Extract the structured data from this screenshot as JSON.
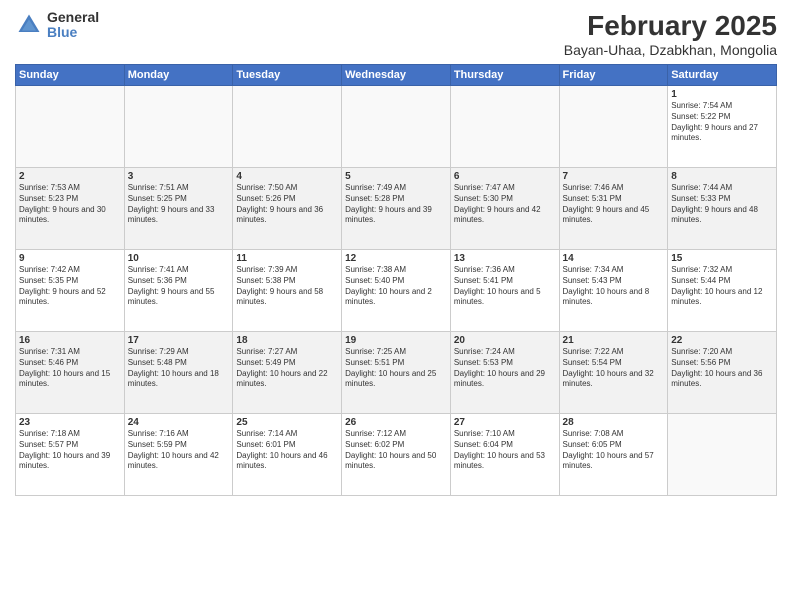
{
  "logo": {
    "general": "General",
    "blue": "Blue"
  },
  "header": {
    "title": "February 2025",
    "subtitle": "Bayan-Uhaa, Dzabkhan, Mongolia"
  },
  "calendar": {
    "headers": [
      "Sunday",
      "Monday",
      "Tuesday",
      "Wednesday",
      "Thursday",
      "Friday",
      "Saturday"
    ],
    "rows": [
      [
        {
          "day": "",
          "info": ""
        },
        {
          "day": "",
          "info": ""
        },
        {
          "day": "",
          "info": ""
        },
        {
          "day": "",
          "info": ""
        },
        {
          "day": "",
          "info": ""
        },
        {
          "day": "",
          "info": ""
        },
        {
          "day": "1",
          "info": "Sunrise: 7:54 AM\nSunset: 5:22 PM\nDaylight: 9 hours and 27 minutes."
        }
      ],
      [
        {
          "day": "2",
          "info": "Sunrise: 7:53 AM\nSunset: 5:23 PM\nDaylight: 9 hours and 30 minutes."
        },
        {
          "day": "3",
          "info": "Sunrise: 7:51 AM\nSunset: 5:25 PM\nDaylight: 9 hours and 33 minutes."
        },
        {
          "day": "4",
          "info": "Sunrise: 7:50 AM\nSunset: 5:26 PM\nDaylight: 9 hours and 36 minutes."
        },
        {
          "day": "5",
          "info": "Sunrise: 7:49 AM\nSunset: 5:28 PM\nDaylight: 9 hours and 39 minutes."
        },
        {
          "day": "6",
          "info": "Sunrise: 7:47 AM\nSunset: 5:30 PM\nDaylight: 9 hours and 42 minutes."
        },
        {
          "day": "7",
          "info": "Sunrise: 7:46 AM\nSunset: 5:31 PM\nDaylight: 9 hours and 45 minutes."
        },
        {
          "day": "8",
          "info": "Sunrise: 7:44 AM\nSunset: 5:33 PM\nDaylight: 9 hours and 48 minutes."
        }
      ],
      [
        {
          "day": "9",
          "info": "Sunrise: 7:42 AM\nSunset: 5:35 PM\nDaylight: 9 hours and 52 minutes."
        },
        {
          "day": "10",
          "info": "Sunrise: 7:41 AM\nSunset: 5:36 PM\nDaylight: 9 hours and 55 minutes."
        },
        {
          "day": "11",
          "info": "Sunrise: 7:39 AM\nSunset: 5:38 PM\nDaylight: 9 hours and 58 minutes."
        },
        {
          "day": "12",
          "info": "Sunrise: 7:38 AM\nSunset: 5:40 PM\nDaylight: 10 hours and 2 minutes."
        },
        {
          "day": "13",
          "info": "Sunrise: 7:36 AM\nSunset: 5:41 PM\nDaylight: 10 hours and 5 minutes."
        },
        {
          "day": "14",
          "info": "Sunrise: 7:34 AM\nSunset: 5:43 PM\nDaylight: 10 hours and 8 minutes."
        },
        {
          "day": "15",
          "info": "Sunrise: 7:32 AM\nSunset: 5:44 PM\nDaylight: 10 hours and 12 minutes."
        }
      ],
      [
        {
          "day": "16",
          "info": "Sunrise: 7:31 AM\nSunset: 5:46 PM\nDaylight: 10 hours and 15 minutes."
        },
        {
          "day": "17",
          "info": "Sunrise: 7:29 AM\nSunset: 5:48 PM\nDaylight: 10 hours and 18 minutes."
        },
        {
          "day": "18",
          "info": "Sunrise: 7:27 AM\nSunset: 5:49 PM\nDaylight: 10 hours and 22 minutes."
        },
        {
          "day": "19",
          "info": "Sunrise: 7:25 AM\nSunset: 5:51 PM\nDaylight: 10 hours and 25 minutes."
        },
        {
          "day": "20",
          "info": "Sunrise: 7:24 AM\nSunset: 5:53 PM\nDaylight: 10 hours and 29 minutes."
        },
        {
          "day": "21",
          "info": "Sunrise: 7:22 AM\nSunset: 5:54 PM\nDaylight: 10 hours and 32 minutes."
        },
        {
          "day": "22",
          "info": "Sunrise: 7:20 AM\nSunset: 5:56 PM\nDaylight: 10 hours and 36 minutes."
        }
      ],
      [
        {
          "day": "23",
          "info": "Sunrise: 7:18 AM\nSunset: 5:57 PM\nDaylight: 10 hours and 39 minutes."
        },
        {
          "day": "24",
          "info": "Sunrise: 7:16 AM\nSunset: 5:59 PM\nDaylight: 10 hours and 42 minutes."
        },
        {
          "day": "25",
          "info": "Sunrise: 7:14 AM\nSunset: 6:01 PM\nDaylight: 10 hours and 46 minutes."
        },
        {
          "day": "26",
          "info": "Sunrise: 7:12 AM\nSunset: 6:02 PM\nDaylight: 10 hours and 50 minutes."
        },
        {
          "day": "27",
          "info": "Sunrise: 7:10 AM\nSunset: 6:04 PM\nDaylight: 10 hours and 53 minutes."
        },
        {
          "day": "28",
          "info": "Sunrise: 7:08 AM\nSunset: 6:05 PM\nDaylight: 10 hours and 57 minutes."
        },
        {
          "day": "",
          "info": ""
        }
      ]
    ]
  }
}
